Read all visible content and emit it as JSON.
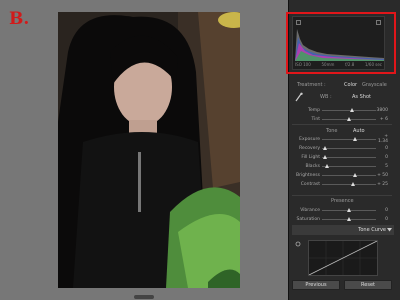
{
  "badge_label": "B.",
  "histogram": {
    "readout": [
      "ISO 100",
      "50mm",
      "f/2.8",
      "1/60 sec"
    ]
  },
  "basic": {
    "treatment_label": "Treatment :",
    "treatment_color": "Color",
    "treatment_grayscale": "Grayscale",
    "wb_label": "WB :",
    "wb_value": "As Shot",
    "tone_label": "Tone",
    "auto_label": "Auto",
    "presence_label": "Presence",
    "sliders_wb": [
      {
        "label": "Temp",
        "value": "3800",
        "level": 0.55
      },
      {
        "label": "Tint",
        "value": "+ 6",
        "level": 0.5
      }
    ],
    "sliders_tone": [
      {
        "label": "Exposure",
        "value": "+ 1.34",
        "level": 0.62
      },
      {
        "label": "Recovery",
        "value": "0",
        "level": 0.05
      },
      {
        "label": "Fill Light",
        "value": "0",
        "level": 0.05
      },
      {
        "label": "Blacks",
        "value": "5",
        "level": 0.1
      },
      {
        "label": "Brightness",
        "value": "+ 50",
        "level": 0.62
      },
      {
        "label": "Contrast",
        "value": "+ 25",
        "level": 0.58
      }
    ],
    "sliders_presence": [
      {
        "label": "Vibrance",
        "value": "0",
        "level": 0.5
      },
      {
        "label": "Saturation",
        "value": "0",
        "level": 0.5
      }
    ]
  },
  "tone_curve_label": "Tone Curve",
  "buttons": {
    "previous": "Previous",
    "reset": "Reset"
  },
  "colors": {
    "highlight_box": "#e0161a",
    "badge": "#d11a1a"
  }
}
